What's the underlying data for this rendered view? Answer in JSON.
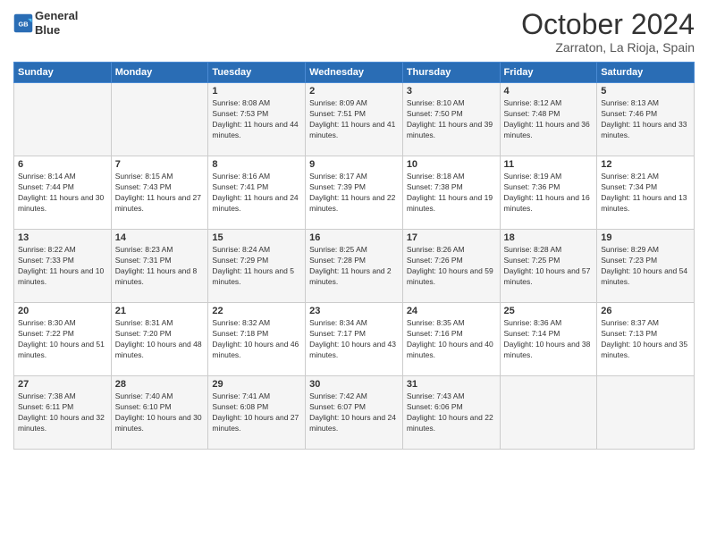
{
  "header": {
    "logo_line1": "General",
    "logo_line2": "Blue",
    "month": "October 2024",
    "location": "Zarraton, La Rioja, Spain"
  },
  "days_of_week": [
    "Sunday",
    "Monday",
    "Tuesday",
    "Wednesday",
    "Thursday",
    "Friday",
    "Saturday"
  ],
  "weeks": [
    [
      {
        "day": "",
        "info": ""
      },
      {
        "day": "",
        "info": ""
      },
      {
        "day": "1",
        "info": "Sunrise: 8:08 AM\nSunset: 7:53 PM\nDaylight: 11 hours and 44 minutes."
      },
      {
        "day": "2",
        "info": "Sunrise: 8:09 AM\nSunset: 7:51 PM\nDaylight: 11 hours and 41 minutes."
      },
      {
        "day": "3",
        "info": "Sunrise: 8:10 AM\nSunset: 7:50 PM\nDaylight: 11 hours and 39 minutes."
      },
      {
        "day": "4",
        "info": "Sunrise: 8:12 AM\nSunset: 7:48 PM\nDaylight: 11 hours and 36 minutes."
      },
      {
        "day": "5",
        "info": "Sunrise: 8:13 AM\nSunset: 7:46 PM\nDaylight: 11 hours and 33 minutes."
      }
    ],
    [
      {
        "day": "6",
        "info": "Sunrise: 8:14 AM\nSunset: 7:44 PM\nDaylight: 11 hours and 30 minutes."
      },
      {
        "day": "7",
        "info": "Sunrise: 8:15 AM\nSunset: 7:43 PM\nDaylight: 11 hours and 27 minutes."
      },
      {
        "day": "8",
        "info": "Sunrise: 8:16 AM\nSunset: 7:41 PM\nDaylight: 11 hours and 24 minutes."
      },
      {
        "day": "9",
        "info": "Sunrise: 8:17 AM\nSunset: 7:39 PM\nDaylight: 11 hours and 22 minutes."
      },
      {
        "day": "10",
        "info": "Sunrise: 8:18 AM\nSunset: 7:38 PM\nDaylight: 11 hours and 19 minutes."
      },
      {
        "day": "11",
        "info": "Sunrise: 8:19 AM\nSunset: 7:36 PM\nDaylight: 11 hours and 16 minutes."
      },
      {
        "day": "12",
        "info": "Sunrise: 8:21 AM\nSunset: 7:34 PM\nDaylight: 11 hours and 13 minutes."
      }
    ],
    [
      {
        "day": "13",
        "info": "Sunrise: 8:22 AM\nSunset: 7:33 PM\nDaylight: 11 hours and 10 minutes."
      },
      {
        "day": "14",
        "info": "Sunrise: 8:23 AM\nSunset: 7:31 PM\nDaylight: 11 hours and 8 minutes."
      },
      {
        "day": "15",
        "info": "Sunrise: 8:24 AM\nSunset: 7:29 PM\nDaylight: 11 hours and 5 minutes."
      },
      {
        "day": "16",
        "info": "Sunrise: 8:25 AM\nSunset: 7:28 PM\nDaylight: 11 hours and 2 minutes."
      },
      {
        "day": "17",
        "info": "Sunrise: 8:26 AM\nSunset: 7:26 PM\nDaylight: 10 hours and 59 minutes."
      },
      {
        "day": "18",
        "info": "Sunrise: 8:28 AM\nSunset: 7:25 PM\nDaylight: 10 hours and 57 minutes."
      },
      {
        "day": "19",
        "info": "Sunrise: 8:29 AM\nSunset: 7:23 PM\nDaylight: 10 hours and 54 minutes."
      }
    ],
    [
      {
        "day": "20",
        "info": "Sunrise: 8:30 AM\nSunset: 7:22 PM\nDaylight: 10 hours and 51 minutes."
      },
      {
        "day": "21",
        "info": "Sunrise: 8:31 AM\nSunset: 7:20 PM\nDaylight: 10 hours and 48 minutes."
      },
      {
        "day": "22",
        "info": "Sunrise: 8:32 AM\nSunset: 7:18 PM\nDaylight: 10 hours and 46 minutes."
      },
      {
        "day": "23",
        "info": "Sunrise: 8:34 AM\nSunset: 7:17 PM\nDaylight: 10 hours and 43 minutes."
      },
      {
        "day": "24",
        "info": "Sunrise: 8:35 AM\nSunset: 7:16 PM\nDaylight: 10 hours and 40 minutes."
      },
      {
        "day": "25",
        "info": "Sunrise: 8:36 AM\nSunset: 7:14 PM\nDaylight: 10 hours and 38 minutes."
      },
      {
        "day": "26",
        "info": "Sunrise: 8:37 AM\nSunset: 7:13 PM\nDaylight: 10 hours and 35 minutes."
      }
    ],
    [
      {
        "day": "27",
        "info": "Sunrise: 7:38 AM\nSunset: 6:11 PM\nDaylight: 10 hours and 32 minutes."
      },
      {
        "day": "28",
        "info": "Sunrise: 7:40 AM\nSunset: 6:10 PM\nDaylight: 10 hours and 30 minutes."
      },
      {
        "day": "29",
        "info": "Sunrise: 7:41 AM\nSunset: 6:08 PM\nDaylight: 10 hours and 27 minutes."
      },
      {
        "day": "30",
        "info": "Sunrise: 7:42 AM\nSunset: 6:07 PM\nDaylight: 10 hours and 24 minutes."
      },
      {
        "day": "31",
        "info": "Sunrise: 7:43 AM\nSunset: 6:06 PM\nDaylight: 10 hours and 22 minutes."
      },
      {
        "day": "",
        "info": ""
      },
      {
        "day": "",
        "info": ""
      }
    ]
  ]
}
